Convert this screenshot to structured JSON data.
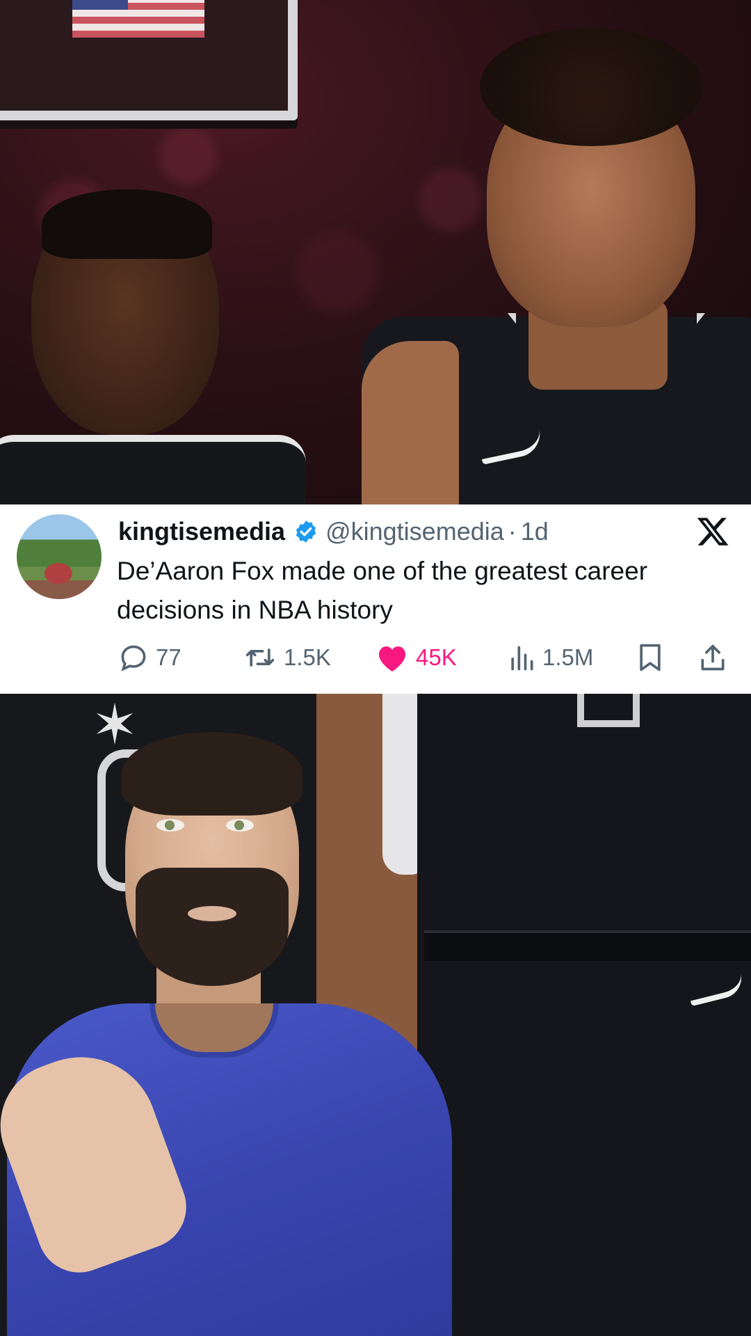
{
  "tweet": {
    "display_name": "kingtisemedia",
    "handle": "@kingtisemedia",
    "separator": "·",
    "time": "1d",
    "text": "De’Aaron Fox made one of the greatest career decisions in NBA history",
    "replies": "77",
    "reposts": "1.5K",
    "likes": "45K",
    "views": "1.5M",
    "icons": {
      "avatar": "avatar-photo",
      "verified": "verified-badge-icon",
      "platform": "x-logo-icon",
      "reply": "reply-icon",
      "repost": "repost-icon",
      "like": "heart-icon",
      "views": "views-bar-icon",
      "bookmark": "bookmark-icon",
      "share": "share-icon"
    },
    "colors": {
      "verified": "#1d9bf0",
      "like": "#f91880",
      "secondary_text": "#536471",
      "primary_text": "#0f1419"
    }
  },
  "images": {
    "top": "nba-players-spurs-photo",
    "bottom": "presenter-overlay-photo"
  }
}
